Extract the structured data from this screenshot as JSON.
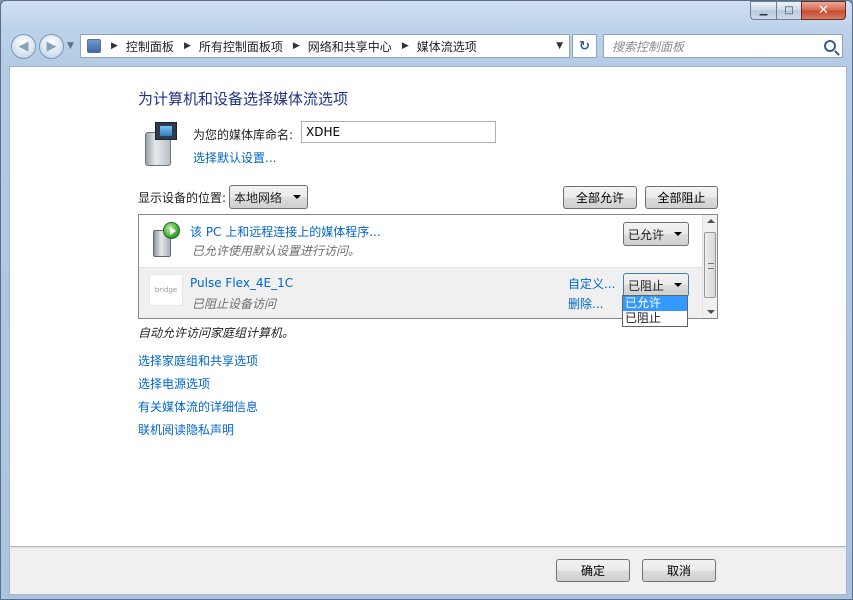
{
  "caption": {
    "minimize": "▭",
    "maximize": "□",
    "close": "✕"
  },
  "address_bar": {
    "crumbs": [
      "控制面板",
      "所有控制面板项",
      "网络和共享中心",
      "媒体流选项"
    ]
  },
  "search": {
    "placeholder": "搜索控制面板"
  },
  "main": {
    "heading": "为计算机和设备选择媒体流选项",
    "library_label": "为您的媒体库命名:",
    "library_name": "XDHE",
    "default_settings_link": "选择默认设置...",
    "show_devices_label": "显示设备的位置:",
    "show_devices_value": "本地网络",
    "allow_all_button": "全部允许",
    "block_all_button": "全部阻止",
    "devices": [
      {
        "title": "该 PC 上和远程连接上的媒体程序...",
        "subtitle": "已允许使用默认设置进行访问。",
        "state": "已允许"
      },
      {
        "title": "Pulse Flex_4E_1C",
        "subtitle": "已阻止设备访问",
        "state": "已阻止",
        "logo_text": "bridge",
        "custom_link": "自定义...",
        "delete_link": "删除..."
      }
    ],
    "dropdown_options": [
      "已允许",
      "已阻止"
    ],
    "auto_note": "自动允许访问家庭组计算机。",
    "links": [
      "选择家庭组和共享选项",
      "选择电源选项",
      "有关媒体流的详细信息",
      "联机阅读隐私声明"
    ]
  },
  "footer": {
    "ok_button": "确定",
    "cancel_button": "取消"
  }
}
